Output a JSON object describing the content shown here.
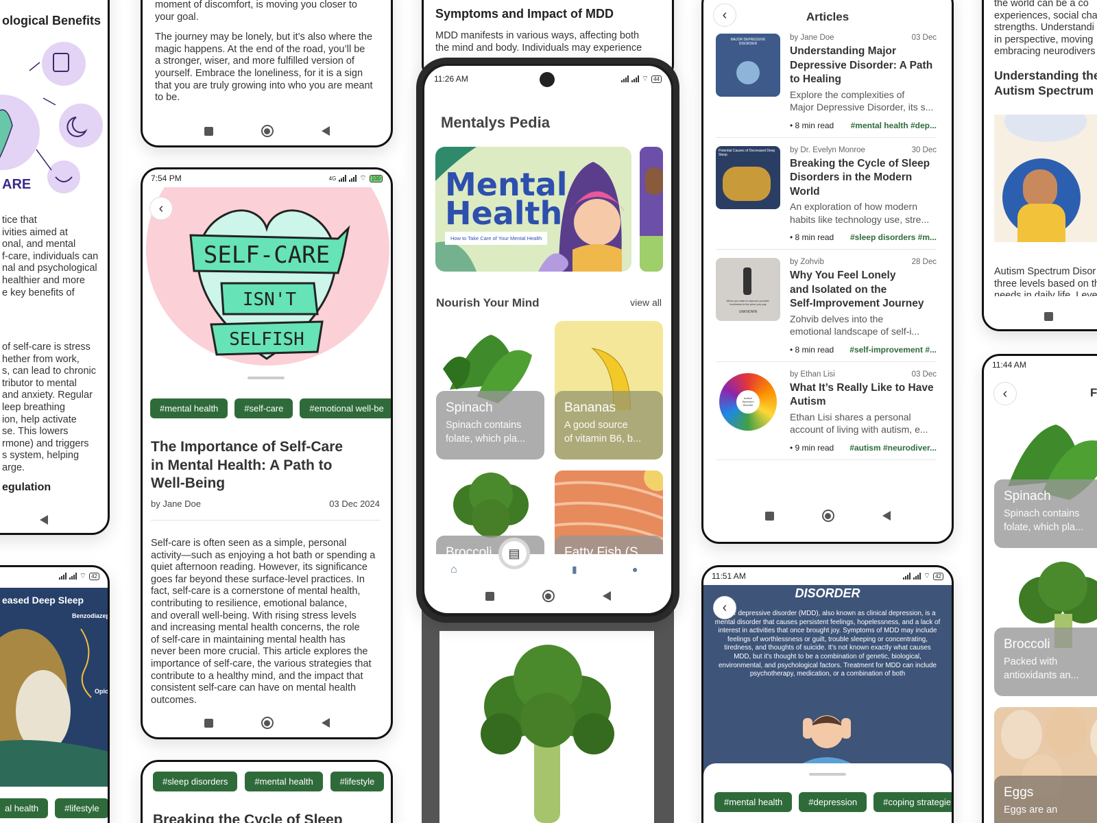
{
  "left_top": {
    "heading": "ological Benefits",
    "art_caption": "ARE",
    "para1": [
      "tice that",
      "ivities aimed at",
      "onal, and mental",
      "f-care, individuals can",
      "nal and psychological",
      "healthier and more",
      "e key benefits of"
    ],
    "para2": [
      "of self-care is stress",
      "hether from work,",
      "s, can lead to chronic",
      "tributor to mental",
      " and anxiety. Regular",
      "leep breathing",
      "ion, help activate",
      "se. This lowers",
      "rmone) and triggers",
      "s system, helping",
      "arge."
    ],
    "subheading": "egulation"
  },
  "left_bottom": {
    "title": "eased Deep Sleep",
    "label1": "Benzodiazepi",
    "label2": "Opioi",
    "tags": [
      "al health",
      "#lifestyle"
    ]
  },
  "col2_top": {
    "para1": [
      "moment of discomfort, is moving you closer to",
      "your goal."
    ],
    "para2": [
      "The journey may be lonely, but it’s also where the",
      "magic happens. At the end of the road, you’ll be",
      "a stronger, wiser, and more fulfilled version of",
      "yourself. Embrace the loneliness, for it is a sign",
      "that you are truly growing into who you are meant",
      "to be."
    ]
  },
  "selfcare_phone": {
    "time": "7:54 PM",
    "battery": "100",
    "net": "4G",
    "hero_lines": [
      "SELF-CARE",
      "ISN'T",
      "SELFISH"
    ],
    "tags": [
      "#mental health",
      "#self-care",
      "#emotional well-be"
    ],
    "title_lines": [
      "The Importance of Self-Care",
      "in Mental Health: A Path to",
      "Well-Being"
    ],
    "author": "by Jane Doe",
    "date": "03 Dec 2024",
    "body_lines": [
      "Self-care is often seen as a simple, personal",
      "activity—such as enjoying a hot bath or spending a",
      "quiet afternoon reading. However, its significance",
      "goes far beyond these surface-level practices. In",
      "fact, self-care is a cornerstone of mental health,",
      "contributing to resilience, emotional balance,",
      "and overall well-being. With rising stress levels",
      "and increasing mental health concerns, the role",
      "of self-care in maintaining mental health has",
      "never been more crucial. This article explores the",
      "importance of self-care, the various strategies that",
      "contribute to a healthy mind, and the impact that",
      "consistent self-care can have on mental health",
      "outcomes."
    ]
  },
  "sleep_card": {
    "tags": [
      "#sleep disorders",
      "#mental health",
      "#lifestyle"
    ],
    "title": "Breaking the Cycle of Sleep"
  },
  "mdd_top": {
    "heading": "Symptoms and Impact of MDD",
    "para": [
      "MDD manifests in various ways, affecting both",
      "the mind and body. Individuals may experience"
    ]
  },
  "main_phone": {
    "time": "11:26 AM",
    "battery": "44",
    "app_title": "Mentalys Pedia",
    "banner_title_1": "Mental",
    "banner_title_2": "Health",
    "banner_subtitle": "How to Take Care of Your Mental Health",
    "section_title": "Nourish Your Mind",
    "view_all": "view all",
    "foods": [
      {
        "name": "Spinach",
        "desc_1": "Spinach contains",
        "desc_2": "folate, which pla..."
      },
      {
        "name": "Bananas",
        "desc_1": "A good source",
        "desc_2": "of vitamin B6, b..."
      },
      {
        "name": "Broccoli",
        "desc_1": "",
        "desc_2": ""
      },
      {
        "name": "Fatty Fish (S",
        "desc_1": "",
        "desc_2": ""
      }
    ],
    "tabs": [
      "home-icon",
      "book-icon",
      "chart-icon",
      "profile-icon"
    ]
  },
  "articles_phone": {
    "title": "Articles",
    "items": [
      {
        "author": "by Jane Doe",
        "date": "03 Dec",
        "title_lines": [
          "Understanding Major",
          "Depressive Disorder: A Path",
          "to Healing"
        ],
        "desc_lines": [
          "Explore the complexities of",
          "Major Depressive Disorder, its s..."
        ],
        "read": "• 8 min read",
        "tags": "#mental health #dep..."
      },
      {
        "author": "by Dr. Evelyn Monroe",
        "date": "30 Dec",
        "title_lines": [
          "Breaking the Cycle of Sleep",
          "Disorders in the Modern",
          "World"
        ],
        "desc_lines": [
          "An exploration of how modern",
          "habits like technology use, stre..."
        ],
        "read": "• 8 min read",
        "tags": "#sleep disorders #m..."
      },
      {
        "author": "by Zohvib",
        "date": "28 Dec",
        "title_lines": [
          "Why You Feel Lonely",
          "and Isolated on the",
          "Self-Improvement Journey"
        ],
        "desc_lines": [
          "Zohvib delves into the",
          "emotional landscape of self-i..."
        ],
        "read": "• 8 min read",
        "tags": "#self-improvement #..."
      },
      {
        "author": "by Ethan Lisi",
        "date": "03 Dec",
        "title_lines": [
          "What It’s Really Like to Have",
          "Autism"
        ],
        "desc_lines": [
          "Ethan Lisi shares a personal",
          "account of living with autism, e..."
        ],
        "read": "• 9 min read",
        "tags": "#autism #neurodiver..."
      }
    ],
    "thumb_text": [
      "MAJOR DEPRESSIVE DISORDER",
      "Potential Causes of Decreased Deep Sleep",
      "When you start to improve yourself, loneliness is the price you pay",
      "UNKNOWN",
      "Autism Spectrum Disorder"
    ]
  },
  "mdd_phone": {
    "time": "11:51 AM",
    "battery": "42",
    "hero_title": "DISORDER",
    "hero_text_lines": [
      "Major depressive disorder (MDD), also known as clinical depression, is a",
      "mental disorder that causes persistent feelings, hopelessness, and a lack of",
      "interest in activities that once brought joy. Symptoms of MDD may include",
      "feelings of worthlessness or guilt, trouble sleeping or concentrating,",
      "tiredness, and thoughts of suicide. It's not known exactly what causes",
      "MDD, but it's thought to be a combination of genetic, biological,",
      "environmental, and psychological factors. Treatment for MDD can include",
      "psychotherapy, medication, or a combination of both"
    ],
    "tags": [
      "#mental health",
      "#depression",
      "#coping strategie"
    ]
  },
  "right_top": {
    "para1": [
      "the world can be a co",
      "experiences, social cha",
      "strengths. Understandi",
      "in perspective, moving",
      "embracing neurodivers"
    ],
    "heading_lines": [
      "Understanding the",
      "Autism Spectrum"
    ],
    "para2": [
      "Autism Spectrum Disor",
      "three levels based on th",
      "needs in daily life. Leve"
    ]
  },
  "right_bottom": {
    "time": "11:44 AM",
    "title_partial": "F",
    "foods": [
      {
        "name": "Spinach",
        "desc_1": "Spinach contains",
        "desc_2": "folate, which pla..."
      },
      {
        "name": "Broccoli",
        "desc_1": "Packed with",
        "desc_2": "antioxidants an..."
      },
      {
        "name": "Eggs",
        "desc_1": "Eggs are an",
        "desc_2": ""
      }
    ]
  }
}
